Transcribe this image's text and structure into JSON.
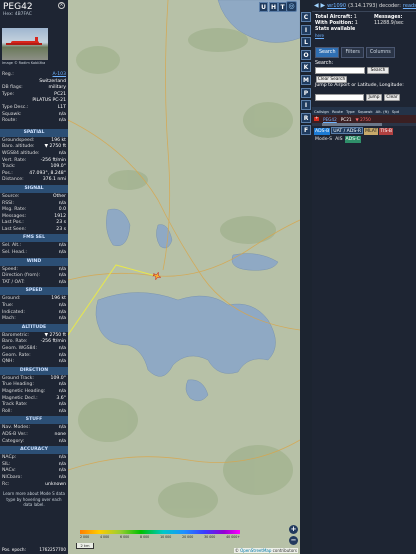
{
  "left_panel": {
    "callsign": "PEG42",
    "hex_label": "Hex:",
    "hex": "4B7FAC",
    "photo_credit": "Image © Radim Koblížka",
    "info_rows": [
      {
        "k": "Reg.:",
        "v": "A-103",
        "link": true
      },
      {
        "k": "",
        "v": "Switzerland",
        "link": false
      },
      {
        "k": "DB flags:",
        "v": "military",
        "link": false
      },
      {
        "k": "Type:",
        "v": "PC21",
        "link": false
      },
      {
        "k": "",
        "v": "PILATUS PC-21",
        "link": false
      },
      {
        "k": "Type Desc.:",
        "v": "L1T",
        "link": false
      },
      {
        "k": "Squawk:",
        "v": "n/a",
        "link": false
      },
      {
        "k": "Route:",
        "v": "n/a",
        "link": false
      }
    ],
    "sections": [
      {
        "title": "SPATIAL",
        "rows": [
          {
            "k": "Groundspeed:",
            "v": "196 kt"
          },
          {
            "k": "Baro. altitude:",
            "v": "▼ 2750 ft"
          },
          {
            "k": "WGS84 altitude:",
            "v": "n/a"
          },
          {
            "k": "Vert. Rate:",
            "v": "-256 ft/min"
          },
          {
            "k": "Track:",
            "v": "109.0°"
          },
          {
            "k": "Pos.:",
            "v": "47.093°, 8.248°"
          },
          {
            "k": "Distance:",
            "v": "376.1 nmi"
          }
        ]
      },
      {
        "title": "SIGNAL",
        "rows": [
          {
            "k": "Source:",
            "v": "Other"
          },
          {
            "k": "RSSI:",
            "v": "n/a"
          },
          {
            "k": "Msg. Rate:",
            "v": "0.0"
          },
          {
            "k": "Messages:",
            "v": "1912"
          },
          {
            "k": "Last Pos.:",
            "v": "23 s"
          },
          {
            "k": "Last Seen:",
            "v": "23 s"
          }
        ]
      },
      {
        "title": "FMS SEL",
        "rows": [
          {
            "k": "Sel. Alt.:",
            "v": "n/a"
          },
          {
            "k": "Sel. Head.:",
            "v": "n/a"
          }
        ]
      },
      {
        "title": "WIND",
        "rows": [
          {
            "k": "Speed:",
            "v": "n/a"
          },
          {
            "k": "Direction (from):",
            "v": "n/a"
          },
          {
            "k": "TAT / OAT:",
            "v": "n/a"
          }
        ]
      },
      {
        "title": "SPEED",
        "rows": [
          {
            "k": "Ground:",
            "v": "196 kt"
          },
          {
            "k": "True:",
            "v": "n/a"
          },
          {
            "k": "Indicated:",
            "v": "n/a"
          },
          {
            "k": "Mach:",
            "v": "n/a"
          }
        ]
      },
      {
        "title": "ALTITUDE",
        "rows": [
          {
            "k": "Barometric:",
            "v": "▼ 2750 ft"
          },
          {
            "k": "Baro. Rate:",
            "v": "-256 ft/min"
          },
          {
            "k": "Geom. WGS84:",
            "v": "n/a"
          },
          {
            "k": "Geom. Rate:",
            "v": "n/a"
          },
          {
            "k": "QNH:",
            "v": "n/a"
          }
        ]
      },
      {
        "title": "DIRECTION",
        "rows": [
          {
            "k": "Ground Track:",
            "v": "109.0°"
          },
          {
            "k": "True Heading:",
            "v": "n/a"
          },
          {
            "k": "Magnetic Heading:",
            "v": "n/a"
          },
          {
            "k": "Magnetic Decl.:",
            "v": "3.6°"
          },
          {
            "k": "Track Rate:",
            "v": "n/a"
          },
          {
            "k": "Roll:",
            "v": "n/a"
          }
        ]
      },
      {
        "title": "STUFF",
        "rows": [
          {
            "k": "Nav. Modes:",
            "v": "n/a"
          },
          {
            "k": "ADS-B Ver.:",
            "v": "none"
          },
          {
            "k": "Category:",
            "v": "n/a"
          }
        ]
      },
      {
        "title": "ACCURACY",
        "rows": [
          {
            "k": "NACp:",
            "v": "n/a"
          },
          {
            "k": "SIL:",
            "v": "n/a"
          },
          {
            "k": "NACv:",
            "v": "n/a"
          },
          {
            "k": "NICbaro:",
            "v": "n/a"
          },
          {
            "k": "Rc:",
            "v": "unknown"
          }
        ]
      }
    ],
    "footer_text": "Learn more about Mode S data type by hovering over each data label.",
    "epoch_label": "Pos. epoch:",
    "epoch_value": "1762257700"
  },
  "map": {
    "top_buttons": [
      "U",
      "H",
      "T"
    ],
    "scale_label": "2 km",
    "altitude_ticks": [
      "2 000",
      "4 000",
      "6 000",
      "8 000",
      "10 000",
      "20 000",
      "30 000",
      "40 000+"
    ],
    "attribution_prefix": "©",
    "attribution_link": "OpenStreetMap",
    "attribution_suffix": "contributors",
    "zoom_in": "+",
    "zoom_out": "−",
    "colors": {
      "water": "#8fa9c4",
      "land": "#b7c1a7",
      "track": "#e8e84a",
      "aircraft": "#f2b233"
    }
  },
  "vertical_buttons": [
    "C",
    "I",
    "L",
    "O",
    "K",
    "M",
    "P",
    "I",
    "R",
    "F"
  ],
  "right_panel": {
    "nav_arrows": "◀ ▶",
    "version_link": "wr1090",
    "version_text": "(3.14.1793) decoder:",
    "decoder_link": "readsb",
    "total_label": "Total Aircraft:",
    "total_value": "1",
    "with_pos_label": "With Position:",
    "with_pos_value": "1",
    "messages_label": "Messages:",
    "messages_value": "11288.9/sec",
    "stats_label": "Stats available",
    "stats_link": "here",
    "tabs": [
      "Search",
      "Filters",
      "Columns"
    ],
    "search_label": "Search:",
    "search_button": "Search",
    "clear_search_button": "Clear Search",
    "jump_label": "Jump to Airport or Latitude, Longitude:",
    "jump_button": "Jump",
    "clear_button": "Clear",
    "table_headers": [
      "Callsign",
      "Route",
      "Type",
      "Squawk",
      "Alt. (ft)",
      "Spd"
    ],
    "table_rows": [
      {
        "callsign": "PEG42",
        "type": "PC21",
        "alt": "▼ 2750"
      }
    ],
    "source_chips": [
      "ADS-B",
      "UAT / ADS-R",
      "MLAT",
      "TIS-B",
      "Mode-S",
      "AIS",
      "ADS-C"
    ]
  }
}
